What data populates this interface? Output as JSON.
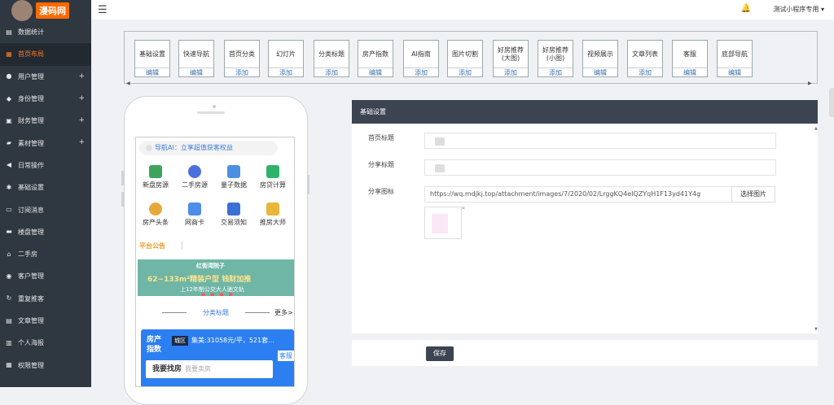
{
  "brand": {
    "logo_text": "漫码网"
  },
  "sidebar": {
    "items": [
      {
        "label": "数据统计",
        "icon": "chart-icon",
        "plus": ""
      },
      {
        "label": "首页布局",
        "icon": "layout-icon",
        "plus": "",
        "active": true
      },
      {
        "label": "用户管理",
        "icon": "user-icon",
        "plus": "+"
      },
      {
        "label": "身份管理",
        "icon": "id-icon",
        "plus": "+"
      },
      {
        "label": "财务管理",
        "icon": "wallet-icon",
        "plus": "+"
      },
      {
        "label": "素材管理",
        "icon": "folder-icon",
        "plus": "+"
      },
      {
        "label": "日常操作",
        "icon": "megaphone-icon",
        "plus": ""
      },
      {
        "label": "基础设置",
        "icon": "gear-icon",
        "plus": ""
      },
      {
        "label": "订阅消息",
        "icon": "message-icon",
        "plus": ""
      },
      {
        "label": "楼盘管理",
        "icon": "building-icon",
        "plus": ""
      },
      {
        "label": "二手房",
        "icon": "house-icon",
        "plus": ""
      },
      {
        "label": "客户管理",
        "icon": "customer-icon",
        "plus": ""
      },
      {
        "label": "重复推客",
        "icon": "repeat-icon",
        "plus": ""
      },
      {
        "label": "文章管理",
        "icon": "article-icon",
        "plus": ""
      },
      {
        "label": "个人海报",
        "icon": "poster-icon",
        "plus": ""
      },
      {
        "label": "权限管理",
        "icon": "permission-icon",
        "plus": ""
      }
    ]
  },
  "topbar": {
    "menu_icon": "☰",
    "bell_icon": "🔔",
    "user_label": "测试小程序专用 ▾"
  },
  "modules": [
    {
      "label": "基础设置",
      "action": "编辑"
    },
    {
      "label": "快速导航",
      "action": "编辑"
    },
    {
      "label": "首页分类",
      "action": "添加"
    },
    {
      "label": "幻灯片",
      "action": "添加"
    },
    {
      "label": "分类标题",
      "action": "添加"
    },
    {
      "label": "房产指数",
      "action": "编辑"
    },
    {
      "label": "AI指南",
      "action": "添加"
    },
    {
      "label": "图片切割",
      "action": "添加"
    },
    {
      "label": "好房推荐\n(大图)",
      "action": "添加"
    },
    {
      "label": "好房推荐\n(小图)",
      "action": "添加"
    },
    {
      "label": "视频展示",
      "action": "编辑"
    },
    {
      "label": "文章列表",
      "action": "添加"
    },
    {
      "label": "客服",
      "action": "编辑"
    },
    {
      "label": "底部导航",
      "action": "编辑"
    }
  ],
  "strip_arrows": {
    "left": "◀",
    "right": "▶"
  },
  "phone": {
    "ai_bar": "导航AI：立享超值获客权益",
    "grid": [
      {
        "label": "新盘房源",
        "icon": "bars-icon",
        "color": "#3ea35c"
      },
      {
        "label": "二手房源",
        "icon": "dots-icon",
        "color": "#4c6fe0"
      },
      {
        "label": "量子数据",
        "icon": "wave-icon",
        "color": "#4a90e2"
      },
      {
        "label": "房贷计算",
        "icon": "hex-icon",
        "color": "#2fb36b"
      },
      {
        "label": "房产头条",
        "icon": "flower-icon",
        "color": "#e4a93a"
      },
      {
        "label": "网商卡",
        "icon": "card-icon",
        "color": "#4c8ee8"
      },
      {
        "label": "交易须知",
        "icon": "columns-icon",
        "color": "#3b6fd8"
      },
      {
        "label": "推房大师",
        "icon": "funnel-icon",
        "color": "#e8b73a"
      }
    ],
    "notice": "平台公告",
    "banner": {
      "top": "红街湾院子",
      "main": "62~133m²精装户型 钱财加推",
      "sub": "上12年制公交大人驰文轨",
      "dots": "● ● ● ●"
    },
    "section_title": "分类标题",
    "more": "更多>",
    "index_card": {
      "title": "房产指数",
      "tag": "城区",
      "data": "集美:31058元/平，521套...",
      "kefu": "客服",
      "search_bold": "我要找房",
      "search_placeholder": "我要卖房"
    }
  },
  "panel": {
    "title": "基础设置",
    "fields": [
      {
        "label": "首页标题"
      },
      {
        "label": "分享标题"
      },
      {
        "label": "分享图标",
        "value": "https://wq.mdjkj.top/attachment/images/7/2020/02/LrggKQ4eIQZYqH1F13yd41Y4g",
        "button": "选择图片"
      }
    ],
    "thumb_close": "×",
    "scroll_up": "▲",
    "scroll_down": "▼",
    "save": "保存"
  }
}
